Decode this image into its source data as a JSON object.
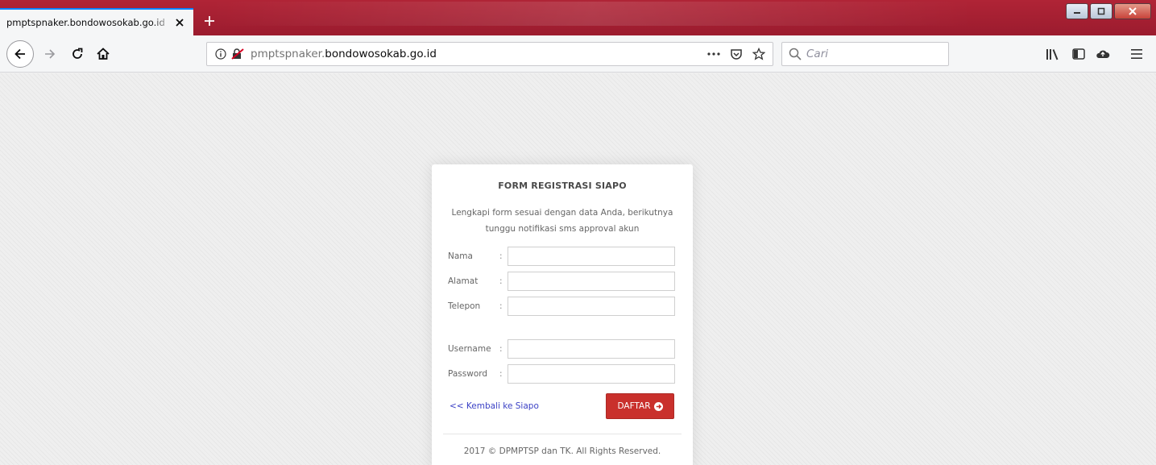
{
  "browser": {
    "tab_title": "pmptspnaker.bondowosokab.go.id",
    "url_prefix": "pmptspnaker.",
    "url_domain": "bondowosokab.go.id",
    "search_placeholder": "Cari",
    "accent_color": "#0a84ff",
    "titlebar_color": "#a11f32"
  },
  "icons": {
    "tab_close": "close-icon",
    "new_tab": "plus-icon",
    "back": "back-arrow-icon",
    "forward": "forward-arrow-icon",
    "reload": "reload-icon",
    "home": "home-icon",
    "page_info": "info-icon",
    "insecure": "insecure-lock-icon",
    "page_actions": "more-icon",
    "pocket": "pocket-icon",
    "bookmark": "star-icon",
    "search": "search-icon",
    "library": "library-icon",
    "sidebar": "sidebar-icon",
    "sync": "cloud-icon",
    "menu": "hamburger-icon"
  },
  "form": {
    "title": "FORM REGISTRASI SIAPO",
    "description": "Lengkapi form sesuai dengan data Anda, berikutnya tunggu notifikasi sms approval akun",
    "colon": ":",
    "fields": {
      "nama": {
        "label": "Nama",
        "value": ""
      },
      "alamat": {
        "label": "Alamat",
        "value": ""
      },
      "telepon": {
        "label": "Telepon",
        "value": ""
      },
      "username": {
        "label": "Username",
        "value": ""
      },
      "password": {
        "label": "Password",
        "value": ""
      }
    },
    "back_link": "<< Kembali ke Siapo",
    "submit_label": "DAFTAR",
    "submit_color": "#c9302c",
    "footer": "2017 © DPMPTSP dan TK. All Rights Reserved."
  }
}
